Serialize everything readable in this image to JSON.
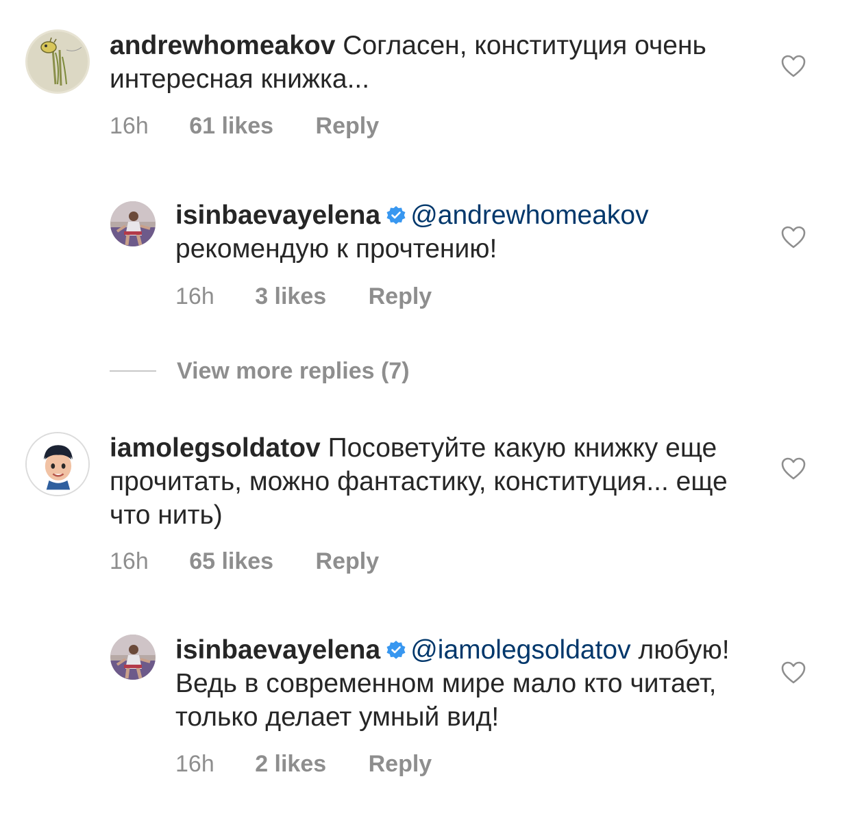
{
  "comments": [
    {
      "username": "andrewhomeakov",
      "text": "Согласен, конституция очень интересная книжка...",
      "time": "16h",
      "likes": "61 likes",
      "reply": "Reply",
      "avatar": "giraffe-drawing-avatar"
    },
    {
      "username": "isinbaevayelena",
      "verified": true,
      "mention": "@andrewhomeakov",
      "text": "рекомендую к прочтению!",
      "time": "16h",
      "likes": "3 likes",
      "reply": "Reply",
      "avatar": "athlete-photo-avatar"
    },
    {
      "username": "iamolegsoldatov",
      "text": "Посоветуйте какую книжку еще прочитать, можно фантастику, конституция... еще что нить)",
      "time": "16h",
      "likes": "65 likes",
      "reply": "Reply",
      "avatar": "memoji-avatar"
    },
    {
      "username": "isinbaevayelena",
      "verified": true,
      "mention": "@iamolegsoldatov",
      "text": "любую! Ведь в современном мире мало кто читает, только делает умный вид!",
      "time": "16h",
      "likes": "2 likes",
      "reply": "Reply",
      "avatar": "athlete-photo-avatar"
    }
  ],
  "view_more_replies": "View more replies (7)",
  "colors": {
    "text": "#262626",
    "meta": "#8e8e8e",
    "mention": "#00376b",
    "verified": "#3897f0"
  },
  "icons": {
    "like": "heart-outline-icon",
    "verified": "verified-badge-icon"
  }
}
